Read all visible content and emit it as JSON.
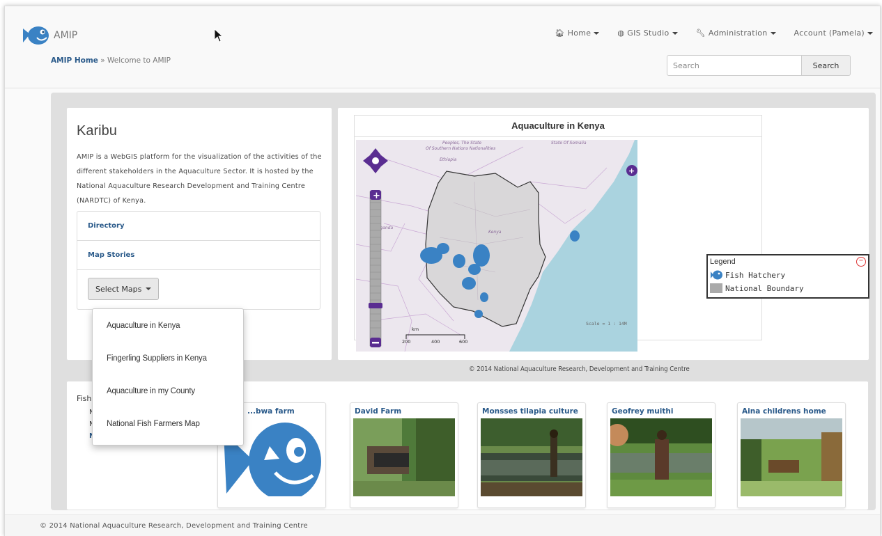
{
  "header": {
    "brand": "AMIP",
    "nav": [
      {
        "icon": "home-icon",
        "label": "Home"
      },
      {
        "icon": "globe-icon",
        "label": "GIS Studio"
      },
      {
        "icon": "wrench-icon",
        "label": "Administration"
      },
      {
        "icon": "",
        "label": "Account (Pamela)"
      }
    ],
    "breadcrumb": {
      "home": "AMIP Home",
      "separator": "»",
      "current": "Welcome to AMIP"
    },
    "search": {
      "placeholder": "Search",
      "button": "Search"
    }
  },
  "intro": {
    "title": "Karibu",
    "text": "AMIP is a WebGIS platform for the visualization of the activities of the different stakeholders in the Aquaculture Sector. It is hosted by the National Aquaculture Research Development and Training Centre (NARDTC) of Kenya.",
    "links": [
      "Directory",
      "Map Stories"
    ],
    "select_maps_label": "Select Maps"
  },
  "dropdown": {
    "items": [
      "Aquaculture in Kenya",
      "Fingerling Suppliers in Kenya",
      "Aquaculture in my County",
      "National Fish Farmers Map"
    ]
  },
  "map": {
    "title": "Aquaculture in Kenya",
    "labels": {
      "peoples": "Peoples, The State",
      "southern": "Of Southern Nations Nationalities",
      "ethiopia": "Ethiopia",
      "somalia": "State Of Somalia",
      "uganda": "Uganda",
      "kenya": "Kenya",
      "scale": "Scale = 1 : 14M",
      "km": "km",
      "ticks": [
        "200",
        "400",
        "600"
      ]
    },
    "legend": {
      "title": "Legend",
      "items": [
        {
          "icon": "fish-icon",
          "label": "Fish Hatchery"
        },
        {
          "icon": "gray-swatch",
          "label": "National Boundary"
        }
      ]
    },
    "copyright": "© 2014 National Aquaculture Research, Development and Training Centre"
  },
  "farms": {
    "section_label": "Fish",
    "sub_items": [
      "N",
      "N",
      "N"
    ],
    "cards": [
      {
        "title": "...bwa farm"
      },
      {
        "title": "David Farm"
      },
      {
        "title": "Monsses tilapia culture"
      },
      {
        "title": "Geofrey muithi"
      },
      {
        "title": "Aina childrens home"
      }
    ]
  },
  "footer": {
    "text": "© 2014 National Aquaculture Research, Development and Training Centre"
  },
  "colors": {
    "link": "#2a5a8a",
    "fish": "#3a82c4",
    "accent": "#5a2d91"
  }
}
